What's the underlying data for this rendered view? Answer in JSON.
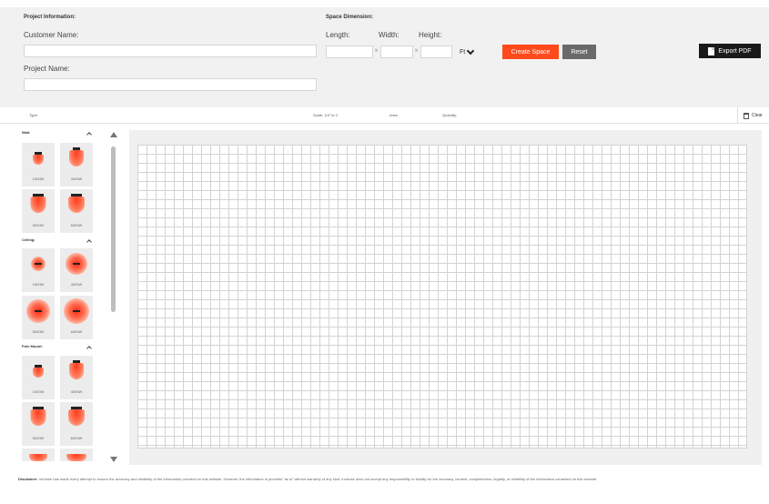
{
  "project": {
    "section_title": "Project Information:",
    "customer_label": "Customer Name:",
    "customer_value": "",
    "project_label": "Project Name:",
    "project_value": ""
  },
  "space": {
    "section_title": "Space Dimension:",
    "length_label": "Length:",
    "width_label": "Width:",
    "height_label": "Height:",
    "length_value": "",
    "width_value": "",
    "height_value": "",
    "x_mark": "x",
    "unit": "Ft",
    "create_label": "Create Space",
    "reset_label": "Reset"
  },
  "export_label": "Export PDF",
  "info_bar": {
    "type_label": "Type:",
    "scale_label": "Scale: 1/4\" to 1'",
    "area_label": "Area:",
    "quantity_label": "Quantity:",
    "clear_label": "Clear"
  },
  "sidebar": {
    "categories": [
      {
        "name": "Wall:",
        "items": [
          "1500W",
          "4000W",
          "5000W",
          "6000W"
        ]
      },
      {
        "name": "Ceiling:",
        "items": [
          "1500W",
          "4000W",
          "5000W",
          "6000W"
        ]
      },
      {
        "name": "Pole Mount:",
        "items": [
          "1500W",
          "4000W",
          "5000W",
          "6000W"
        ]
      }
    ]
  },
  "disclaimer": {
    "title": "Disclaimer:",
    "text": "Ironfuse has made every attempt to ensure the accuracy and reliability of the information provided on this website. However, the information is provided \"as is\" without warranty of any kind. Ironfuse does not accept any responsibility or liability for the accuracy, content, completeness, legality, or reliability of the information contained on this website."
  },
  "colors": {
    "accent": "#ff4a1c",
    "reset": "#6a6a6a",
    "pdf": "#1a1a1a",
    "panel": "#f1f1f1"
  }
}
